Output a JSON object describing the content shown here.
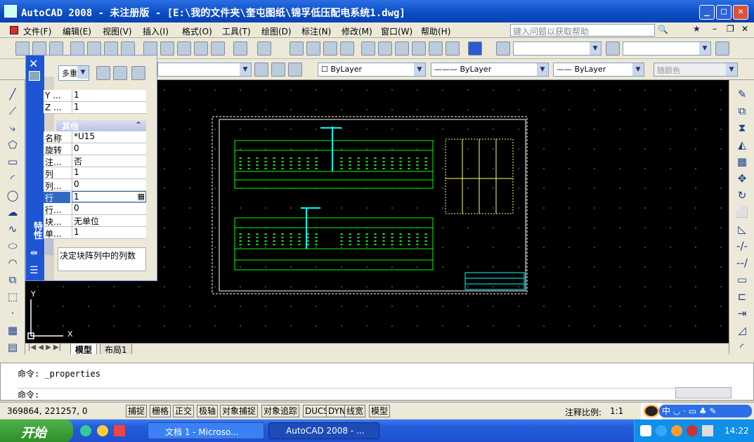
{
  "window": {
    "title": "AutoCAD 2008 - 未注册版 - [E:\\我的文件夹\\奎屯图纸\\锦孚低压配电系统1.dwg]"
  },
  "menu": [
    "文件(F)",
    "编辑(E)",
    "视图(V)",
    "插入(I)",
    "格式(O)",
    "工具(T)",
    "绘图(D)",
    "标注(N)",
    "修改(M)",
    "窗口(W)",
    "帮助(H)"
  ],
  "help_placeholder": "键入问题以获取帮助",
  "layers": {
    "linetype": "ByLayer",
    "lineweight": "ByLayer",
    "linetype2": "ByLayer",
    "color": "随颜色"
  },
  "props": {
    "selector": "多重",
    "top_rows": [
      {
        "k": "Y ...",
        "v": "1"
      },
      {
        "k": "Z ...",
        "v": "1"
      }
    ],
    "section": "其他",
    "rows": [
      {
        "k": "名称",
        "v": "*U15"
      },
      {
        "k": "旋转",
        "v": "0"
      },
      {
        "k": "注...",
        "v": "否"
      },
      {
        "k": "列",
        "v": "1"
      },
      {
        "k": "列...",
        "v": "0"
      },
      {
        "k": "行",
        "v": "1"
      },
      {
        "k": "行...",
        "v": "0"
      },
      {
        "k": "块...",
        "v": "无单位"
      },
      {
        "k": "单...",
        "v": "1"
      }
    ],
    "description": "决定块阵列中的列数",
    "vertical_title": "特性"
  },
  "ucs": {
    "x": "X",
    "y": "Y"
  },
  "tabs": [
    "模型",
    "布局1"
  ],
  "command": {
    "line1": "命令:  _properties",
    "line2": "命令:"
  },
  "status": {
    "coords": "369864, 221257, 0",
    "buttons": [
      "捕捉",
      "栅格",
      "正交",
      "极轴",
      "对象捕捉",
      "对象追踪",
      "DUCS",
      "DYN",
      "线宽",
      "模型"
    ],
    "scale_label": "注释比例:",
    "scale": "1:1"
  },
  "taskbar": {
    "start": "开始",
    "tasks": [
      "文档 1 - Microso...",
      "AutoCAD 2008 - ..."
    ],
    "clock": "14:22"
  },
  "colors": {
    "drawing": "#00ff00",
    "frame": "#ffffff",
    "table": "#ffff66",
    "cyan": "#00ffff"
  }
}
